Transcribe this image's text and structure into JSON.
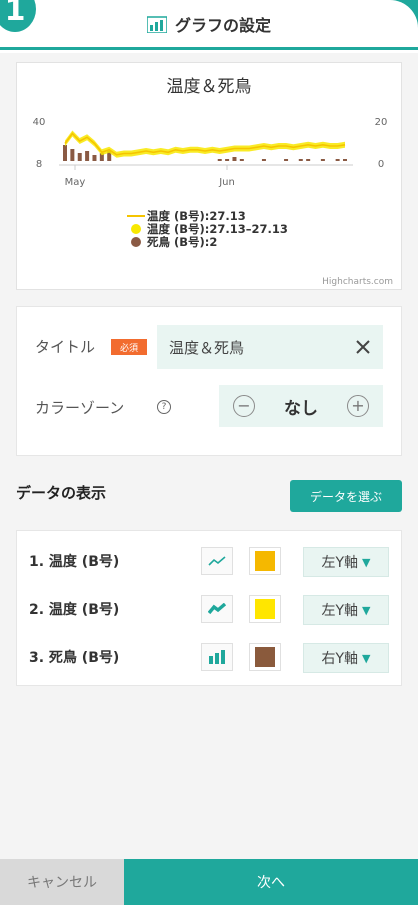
{
  "header": {
    "step": "1",
    "title": "グラフの設定",
    "icon": "chart-settings-icon"
  },
  "chart_data": {
    "type": "line",
    "title": "温度＆死鳥",
    "x_tick_labels": [
      "May",
      "Jun"
    ],
    "y_left_ticks": [
      "40",
      "8"
    ],
    "y_right_ticks": [
      "20",
      "0"
    ],
    "series": [
      {
        "name": "温度 (B号):27.13",
        "kind": "line",
        "color": "#f5c400"
      },
      {
        "name": "温度 (B号):27.13–27.13",
        "kind": "range",
        "color": "#f8e800"
      },
      {
        "name": "死鳥 (B号):2",
        "kind": "bar",
        "color": "#8a5a44"
      }
    ],
    "temperature_series": [
      22,
      30,
      24,
      27,
      22,
      15,
      17,
      13,
      14,
      14,
      15,
      16,
      15,
      16,
      15,
      17,
      16,
      17,
      17,
      16,
      17,
      16,
      17,
      18,
      18,
      18,
      19,
      20,
      19,
      20,
      20,
      19,
      20,
      21,
      20,
      21,
      20,
      20,
      21
    ],
    "deaths_series": [
      8,
      6,
      4,
      5,
      3,
      4,
      5,
      0,
      0,
      0,
      0,
      0,
      0,
      0,
      0,
      0,
      0,
      0,
      0,
      0,
      0,
      1,
      1,
      2,
      1,
      0,
      0,
      1,
      0,
      0,
      1,
      0,
      1,
      1,
      0,
      1,
      0,
      1,
      1
    ],
    "legend_placement": "bottom-center",
    "credit": "Highcharts.com"
  },
  "settings": {
    "title_label": "タイトル",
    "required_badge": "必須",
    "title_value": "温度＆死鳥",
    "color_zone_label": "カラーゾーン",
    "color_zone_value": "なし"
  },
  "data_section": {
    "heading": "データの表示",
    "choose_button": "データを選ぶ",
    "rows": [
      {
        "label": "1. 温度 (B号)",
        "type_icon": "line-chart-icon",
        "color": "#f5b800",
        "axis": "左Y軸"
      },
      {
        "label": "2. 温度 (B号)",
        "type_icon": "range-chart-icon",
        "color": "#ffe600",
        "axis": "左Y軸"
      },
      {
        "label": "3. 死鳥 (B号)",
        "type_icon": "bar-chart-icon",
        "color": "#8a5a3c",
        "axis": "右Y軸"
      }
    ]
  },
  "footer": {
    "cancel": "キャンセル",
    "next": "次へ"
  },
  "colors": {
    "accent": "#1fa89c",
    "required": "#f26c2f"
  }
}
